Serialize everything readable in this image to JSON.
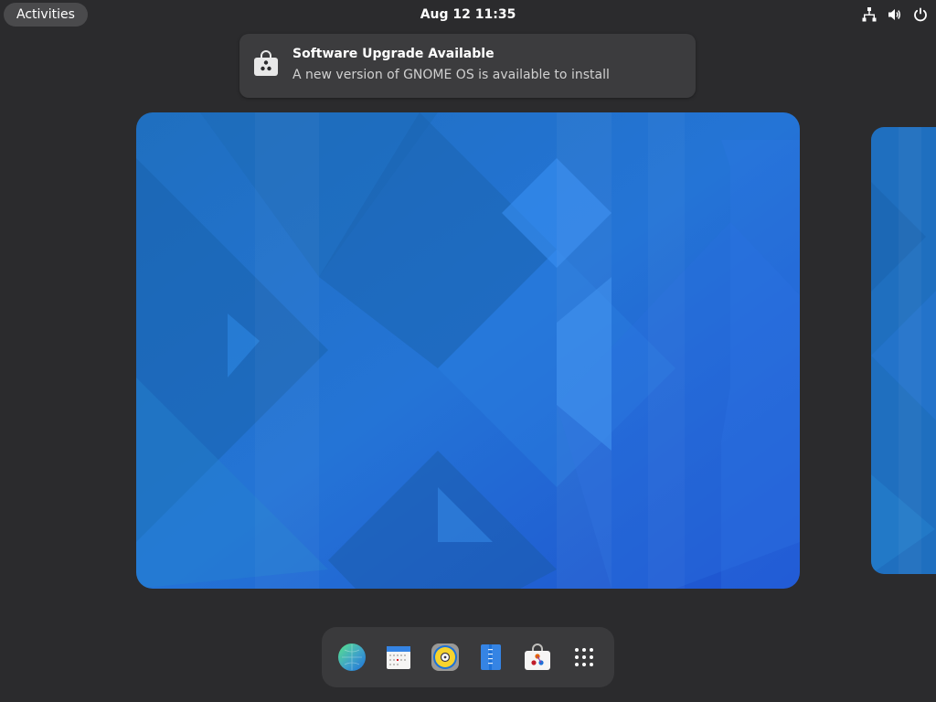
{
  "topbar": {
    "activities_label": "Activities",
    "clock": "Aug 12  11:35",
    "status_icons": [
      "network-wired-icon",
      "volume-icon",
      "power-icon"
    ]
  },
  "notification": {
    "icon": "software-store-icon",
    "title": "Software Upgrade Available",
    "body": "A new version of GNOME OS is available to install"
  },
  "workspaces": {
    "wallpaper_colors": [
      "#1e6fc9",
      "#2a7be0",
      "#1a5fb0",
      "#3a8cf0"
    ]
  },
  "dash": {
    "apps": [
      {
        "name": "Web",
        "icon": "web-browser-icon"
      },
      {
        "name": "Calendar",
        "icon": "calendar-icon"
      },
      {
        "name": "Rhythmbox",
        "icon": "music-player-icon"
      },
      {
        "name": "Text Editor",
        "icon": "text-editor-icon"
      },
      {
        "name": "Software",
        "icon": "software-store-icon"
      },
      {
        "name": "Show Apps",
        "icon": "app-grid-icon"
      }
    ]
  },
  "colors": {
    "background": "#2b2b2d",
    "accent": "#3584e4"
  }
}
